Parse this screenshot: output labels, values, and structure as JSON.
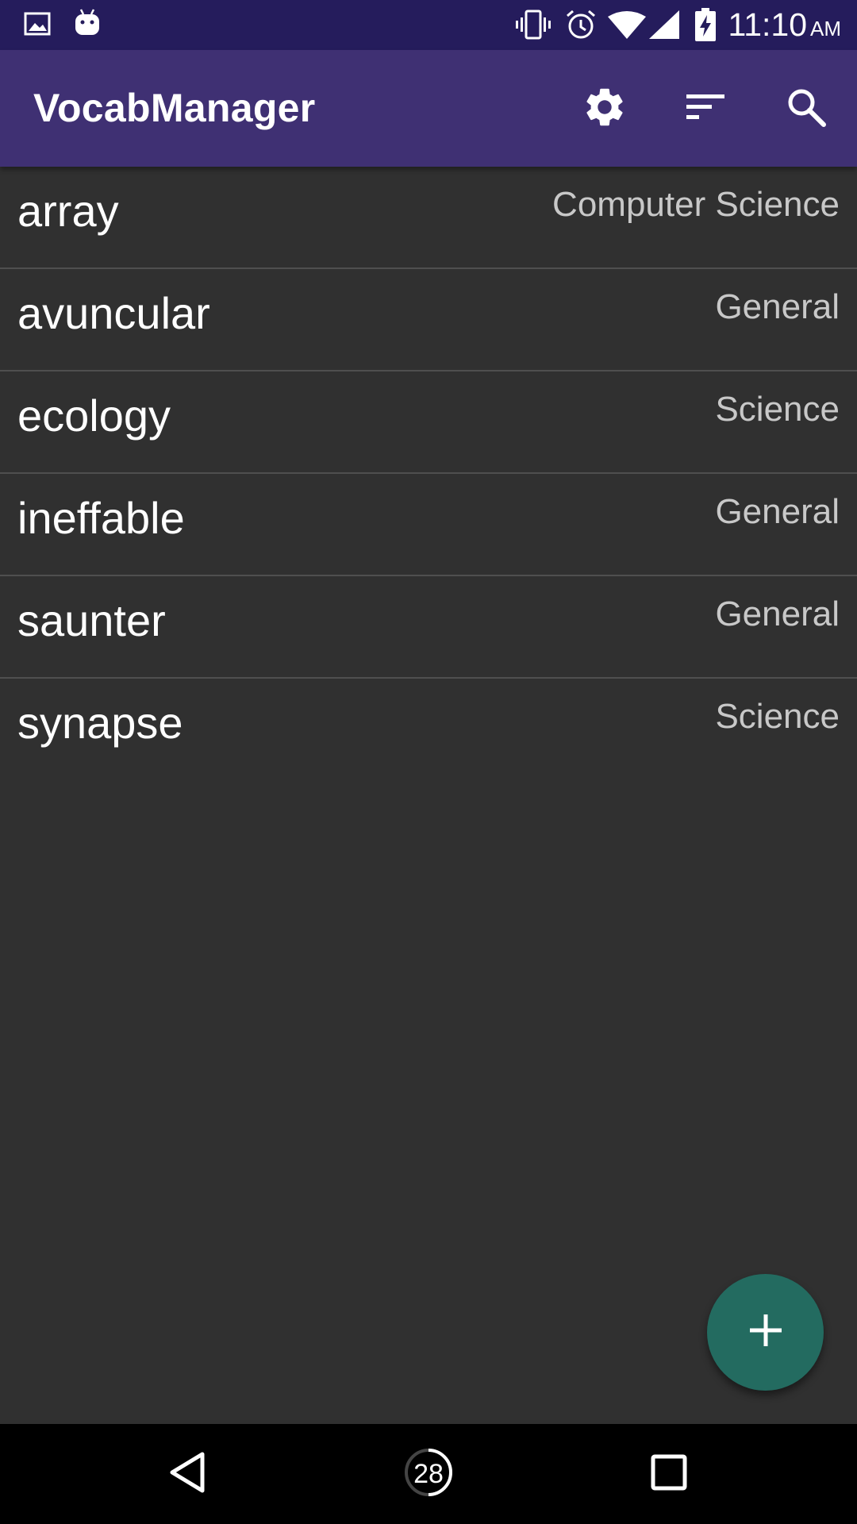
{
  "status_bar": {
    "time": "11:10",
    "ampm": "AM",
    "icons": [
      "image-icon",
      "android-icon",
      "vibrate-icon",
      "alarm-icon",
      "wifi-icon",
      "signal-icon",
      "battery-charging-icon"
    ]
  },
  "app_bar": {
    "title": "VocabManager",
    "actions": [
      "gear-icon",
      "sort-icon",
      "search-icon"
    ]
  },
  "words": [
    {
      "word": "array",
      "category": "Computer Science"
    },
    {
      "word": "avuncular",
      "category": "General"
    },
    {
      "word": "ecology",
      "category": "Science"
    },
    {
      "word": "ineffable",
      "category": "General"
    },
    {
      "word": "saunter",
      "category": "General"
    },
    {
      "word": "synapse",
      "category": "Science"
    }
  ],
  "fab": {
    "icon": "plus-icon"
  },
  "nav_bar": {
    "home_badge": "28",
    "buttons": [
      "back-icon",
      "home-icon",
      "recents-icon"
    ]
  },
  "colors": {
    "status_bar": "#251c5c",
    "app_bar": "#3f3073",
    "background": "#303030",
    "divider": "#4f4f4f",
    "fab": "#236b60",
    "category_text": "#c8c8c8"
  }
}
